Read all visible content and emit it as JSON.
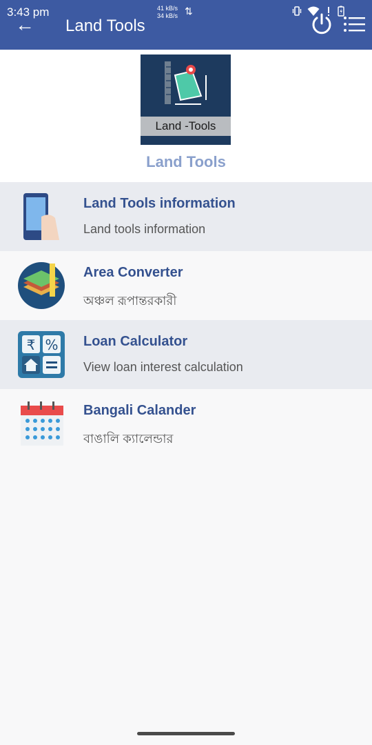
{
  "status_bar": {
    "time": "3:43 pm",
    "net_down": "41 kB/s",
    "net_up": "34 kB/s",
    "net_arrows": "⇅",
    "icons": [
      "vibrate-icon",
      "wifi-icon",
      "signal-icon",
      "battery-icon"
    ]
  },
  "app_bar": {
    "back_glyph": "←",
    "title": "Land Tools",
    "background": "#3d5aa2"
  },
  "header": {
    "logo_text": "Land -Tools",
    "title": "Land Tools"
  },
  "items": [
    {
      "title": "Land Tools information",
      "subtitle": "Land tools information",
      "icon": "phone-hand-icon"
    },
    {
      "title": "Area Converter",
      "subtitle": "অঞ্চল রূপান্তরকারী",
      "icon": "area-layers-icon"
    },
    {
      "title": "Loan Calculator",
      "subtitle": "View loan interest calculation",
      "icon": "calculator-icon"
    },
    {
      "title": "Bangali Calander",
      "subtitle": "বাঙালি ক্যালেন্ডার",
      "icon": "calendar-icon"
    }
  ]
}
